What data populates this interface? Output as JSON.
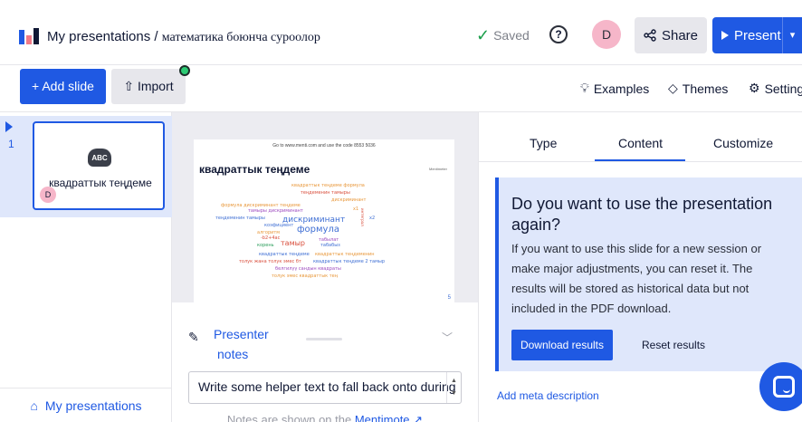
{
  "header": {
    "breadcrumb_root": "My presentations",
    "breadcrumb_sep": "/",
    "presentation_title": "математика боюнча суроолор",
    "saved_label": "Saved",
    "help_symbol": "?",
    "avatar_initial": "D",
    "share_label": "Share",
    "present_label": "Present"
  },
  "toolbar": {
    "add_slide_label": "+ Add slide",
    "import_label": "Import",
    "examples_label": "Examples",
    "themes_label": "Themes",
    "settings_label": "Settings"
  },
  "slides": {
    "items": [
      {
        "number": "1",
        "icon_text": "ABC",
        "name": "квадраттык теңдеме",
        "avatar_initial": "D"
      }
    ],
    "my_presentations_label": "My presentations"
  },
  "preview": {
    "goto_text": "Go to www.menti.com and use the code 8553 5036",
    "title": "квадраттык теңдеме",
    "brand": "Mentimeter",
    "page_number": "5",
    "words": [
      {
        "text": "квадраттык теңдеме формула",
        "color": "#e8973a"
      },
      {
        "text": "теңдеменин тамыры",
        "color": "#d94f3d"
      },
      {
        "text": "дискриминант",
        "color": "#e8973a"
      },
      {
        "text": "формула дискриминант теңдеме",
        "color": "#e8973a"
      },
      {
        "text": "тамыры дискриминант",
        "color": "#9d4bbf"
      },
      {
        "text": "теңдеменин тамыры",
        "color": "#3f6fd4"
      },
      {
        "text": "дискриминант",
        "color": "#3f6fd4"
      },
      {
        "text": "x1",
        "color": "#e8973a"
      },
      {
        "text": "x2",
        "color": "#3f6fd4"
      },
      {
        "text": "интеграл",
        "color": "#d94f3d"
      },
      {
        "text": "коэфициент",
        "color": "#3f6fd4"
      },
      {
        "text": "формула",
        "color": "#3f6fd4"
      },
      {
        "text": "алгоритм",
        "color": "#e8973a"
      },
      {
        "text": "табылат",
        "color": "#9d4bbf"
      },
      {
        "text": "-b2+4ac",
        "color": "#d94f3d"
      },
      {
        "text": "тамыр",
        "color": "#d94f3d"
      },
      {
        "text": "корень",
        "color": "#2a9d5a"
      },
      {
        "text": "табабыз",
        "color": "#3f6fd4"
      },
      {
        "text": "квадраттык теңдеме",
        "color": "#3f6fd4"
      },
      {
        "text": "квадраттык теңдеменин",
        "color": "#e8973a"
      },
      {
        "text": "толук жана толук эмес бт",
        "color": "#d94f3d"
      },
      {
        "text": "квадраттык теңдеме 2 тамыр",
        "color": "#3f6fd4"
      },
      {
        "text": "белгилүү сандын квадраты",
        "color": "#9d4bbf"
      },
      {
        "text": "толук эмес квадраттык тең",
        "color": "#e8973a"
      }
    ]
  },
  "notes": {
    "label_line1": "Presenter",
    "label_line2": "notes",
    "input_value": "Write some helper text to fall back onto during",
    "shown_prefix": "Notes are shown on the",
    "shown_link": "Mentimote"
  },
  "panel": {
    "tabs": [
      "Type",
      "Content",
      "Customize"
    ],
    "active_tab": "Content",
    "reset_heading": "Do you want to use the presentation again?",
    "reset_body": "If you want to use this slide for a new session or make major adjustments, you can reset it. The results will be stored as historical data but not included in the PDF download.",
    "download_label": "Download results",
    "reset_label": "Reset results",
    "meta_link": "Add meta description"
  },
  "colors": {
    "accent": "#1f59e3",
    "saved_check": "#1a9e4a",
    "avatar_bg": "#f6b6c9",
    "import_badge": "#2dcb74",
    "panel_bg": "#ececf1",
    "info_bg": "#dfe7fb"
  },
  "icons": [
    "logo-icon",
    "check-icon",
    "help-icon",
    "share-icon",
    "play-icon",
    "chevron-down-icon",
    "upload-icon",
    "bulb-icon",
    "themes-icon",
    "gear-icon",
    "cloud-icon",
    "home-icon",
    "pen-icon",
    "external-link-icon",
    "chat-icon"
  ]
}
